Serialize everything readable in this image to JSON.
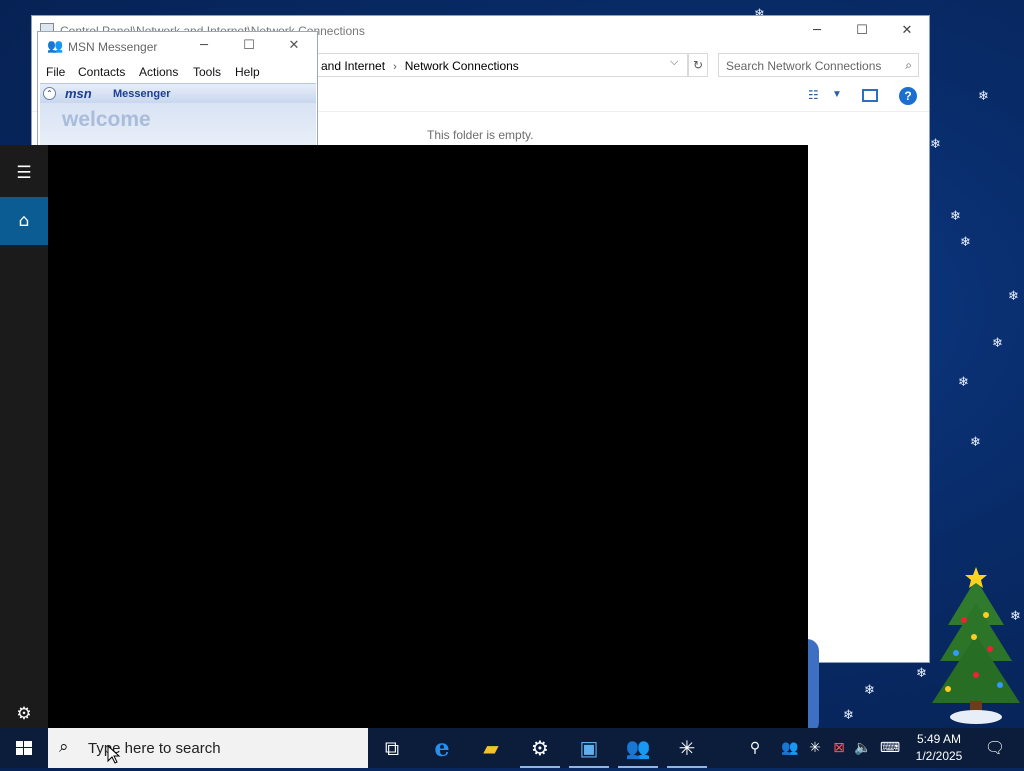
{
  "explorer": {
    "title": "Control Panel\\Network and Internet\\Network Connections",
    "breadcrumb": [
      "and Internet",
      "Network Connections"
    ],
    "search_placeholder": "Search Network Connections",
    "empty_message": "This folder is empty."
  },
  "msn": {
    "title": "MSN Messenger",
    "menu": [
      "File",
      "Contacts",
      "Actions",
      "Tools",
      "Help"
    ],
    "brand": "msn",
    "brand_product": "Messenger",
    "welcome": "welcome"
  },
  "taskbar": {
    "search_placeholder": "Type here to search",
    "time": "5:49 AM",
    "date": "1/2/2025"
  },
  "colors": {
    "start_accent": "#0b5c93",
    "taskbar": "#0b1d3a",
    "desktop": "#082a66"
  }
}
